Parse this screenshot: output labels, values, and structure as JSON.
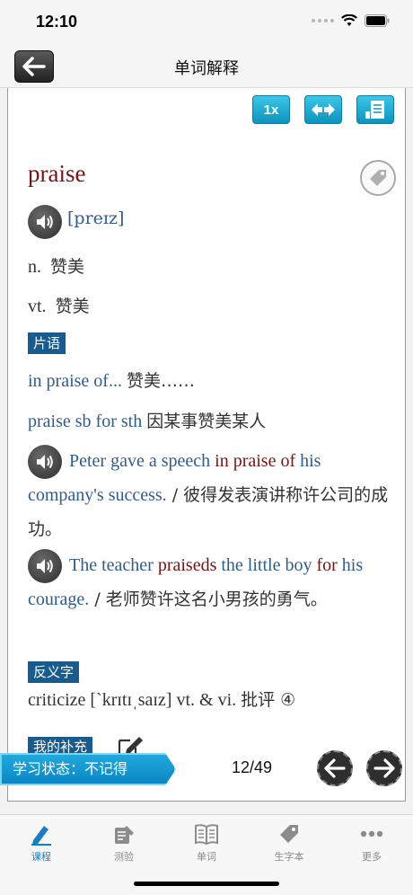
{
  "status_bar": {
    "time": "12:10"
  },
  "nav": {
    "title": "单词解释"
  },
  "toolbar": {
    "speed_label": "1x"
  },
  "entry": {
    "word": "praise",
    "phonetic": "[preɪz]",
    "definitions": [
      {
        "pos": "n.",
        "meaning": "赞美"
      },
      {
        "pos": "vt.",
        "meaning": "赞美"
      }
    ]
  },
  "phrases": {
    "label": "片语",
    "items": [
      {
        "en": "in praise of...",
        "cn": "赞美……"
      },
      {
        "en": "praise sb for sth",
        "cn": "因某事赞美某人"
      }
    ]
  },
  "examples": [
    {
      "before": "Peter gave a speech ",
      "highlight": "in praise of",
      "after": " his company's success.",
      "cn": " / 彼得发表演讲称许公司的成功。"
    },
    {
      "before": "The teacher ",
      "highlight": "praiseds",
      "middle": " the little boy ",
      "highlight2": "for",
      "after": " his courage.",
      "cn": " / 老师赞许这名小男孩的勇气。"
    }
  ],
  "antonym": {
    "label": "反义字",
    "text": "criticize [`krɪtɪˌsaɪz] vt. & vi.",
    "cn": "批评 ④"
  },
  "my_notes": {
    "label": "我的补充"
  },
  "footer": {
    "study_status": "学习状态：不记得",
    "page_counter": "12/49"
  },
  "tabs": [
    {
      "label": "课程",
      "icon": "pencil-icon",
      "active": true
    },
    {
      "label": "测验",
      "icon": "quiz-icon",
      "active": false
    },
    {
      "label": "单词",
      "icon": "book-icon",
      "active": false
    },
    {
      "label": "生字本",
      "icon": "tag-icon",
      "active": false
    },
    {
      "label": "更多",
      "icon": "more-dots-icon",
      "active": false
    }
  ],
  "colors": {
    "accent": "#1a7ec4",
    "word": "#7a1414",
    "english_text": "#2f5c8c",
    "section_label_bg": "#1a5b8e"
  }
}
